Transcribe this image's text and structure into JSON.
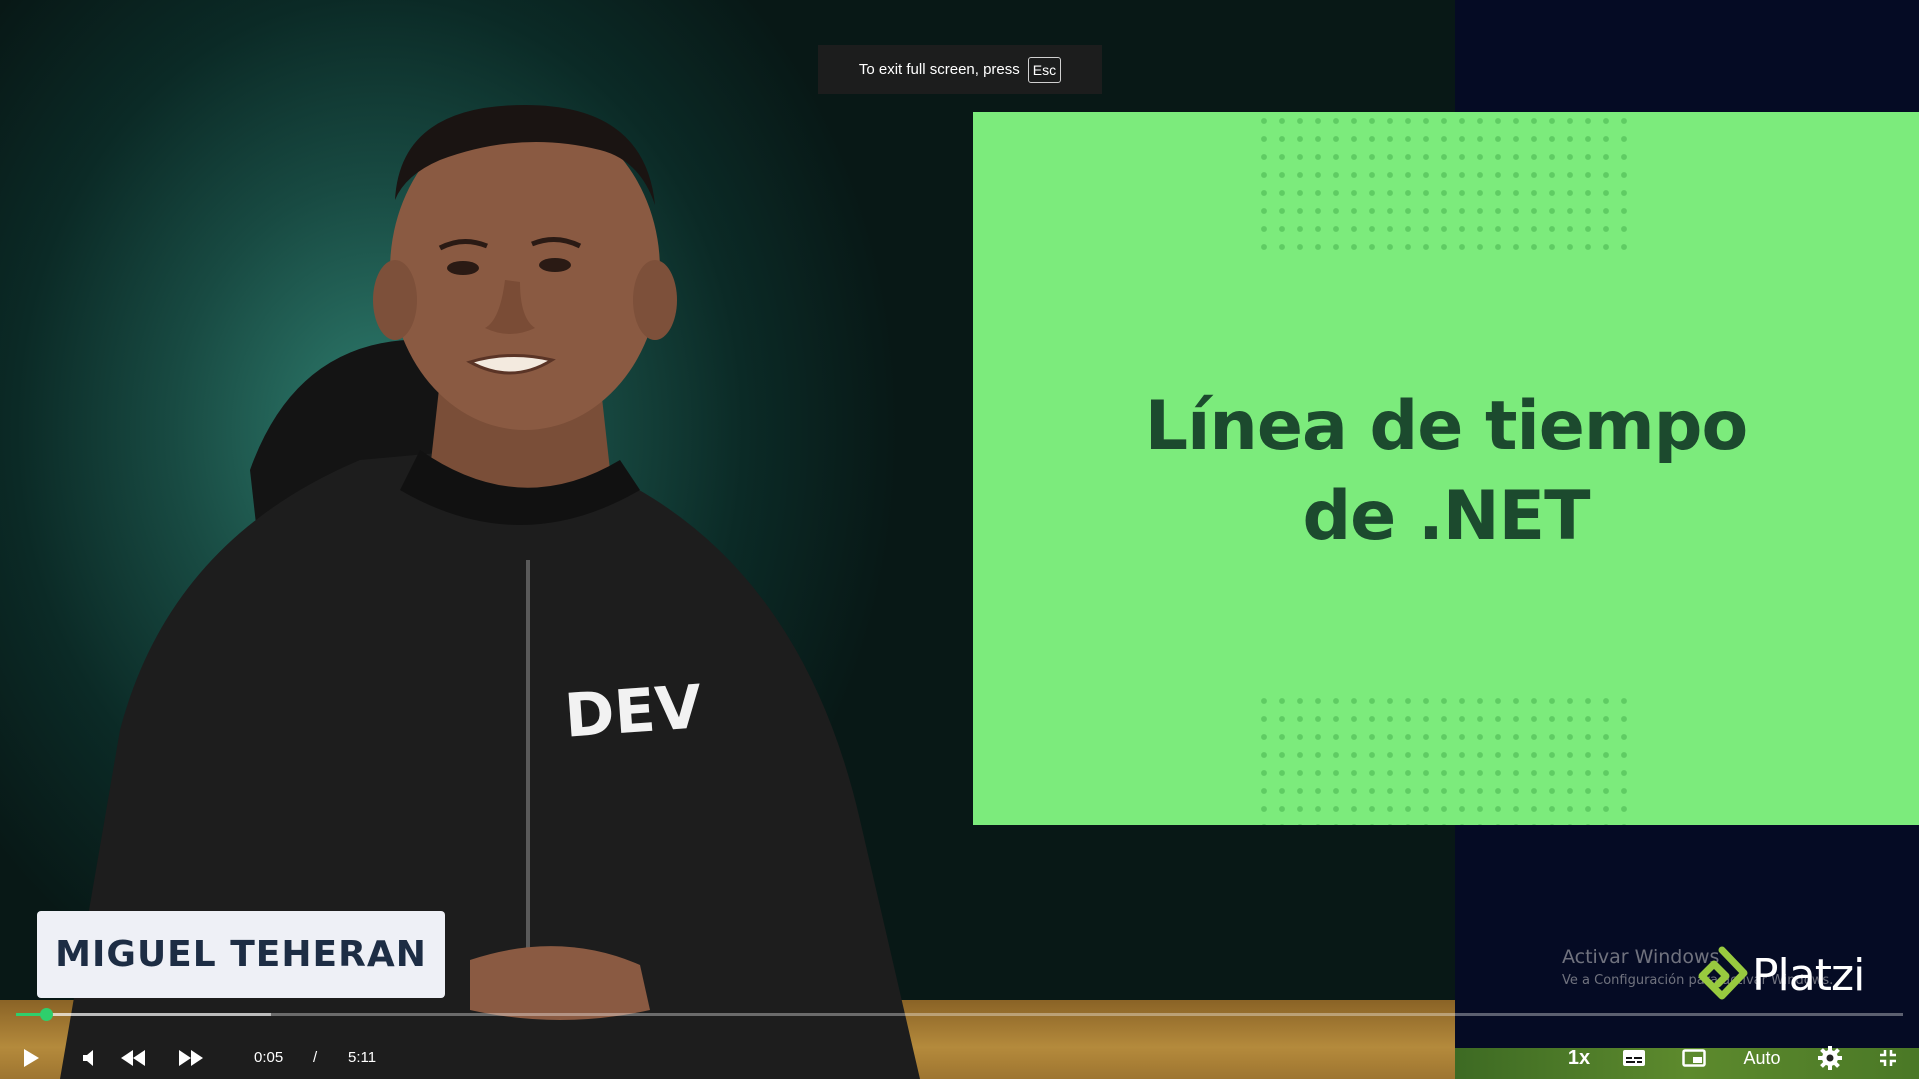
{
  "notice": {
    "text": "To exit full screen, press",
    "key": "Esc"
  },
  "slide": {
    "title_line1": "Línea de tiempo",
    "title_line2": "de .NET",
    "background": "#7ceb7c",
    "text_color": "#1c4a2e"
  },
  "speaker": {
    "name": "MIGUEL TEHERAN",
    "shirt_text": "DEV"
  },
  "watermark": {
    "line1": "Activar Windows",
    "line2": "Ve a Configuración para activar Windows."
  },
  "brand": {
    "name": "Platzi",
    "color": "#98ca3f"
  },
  "player": {
    "current_time": "0:05",
    "separator": "/",
    "duration": "5:11",
    "speed": "1x",
    "quality": "Auto",
    "progress_fraction": 0.016,
    "buffered_fraction": 0.135,
    "accent": "#2ecf6c",
    "icons": [
      "play-icon",
      "volume-icon",
      "rewind-icon",
      "fast-forward-icon",
      "subtitles-icon",
      "picture-in-picture-icon",
      "settings-icon",
      "exit-fullscreen-icon"
    ]
  }
}
